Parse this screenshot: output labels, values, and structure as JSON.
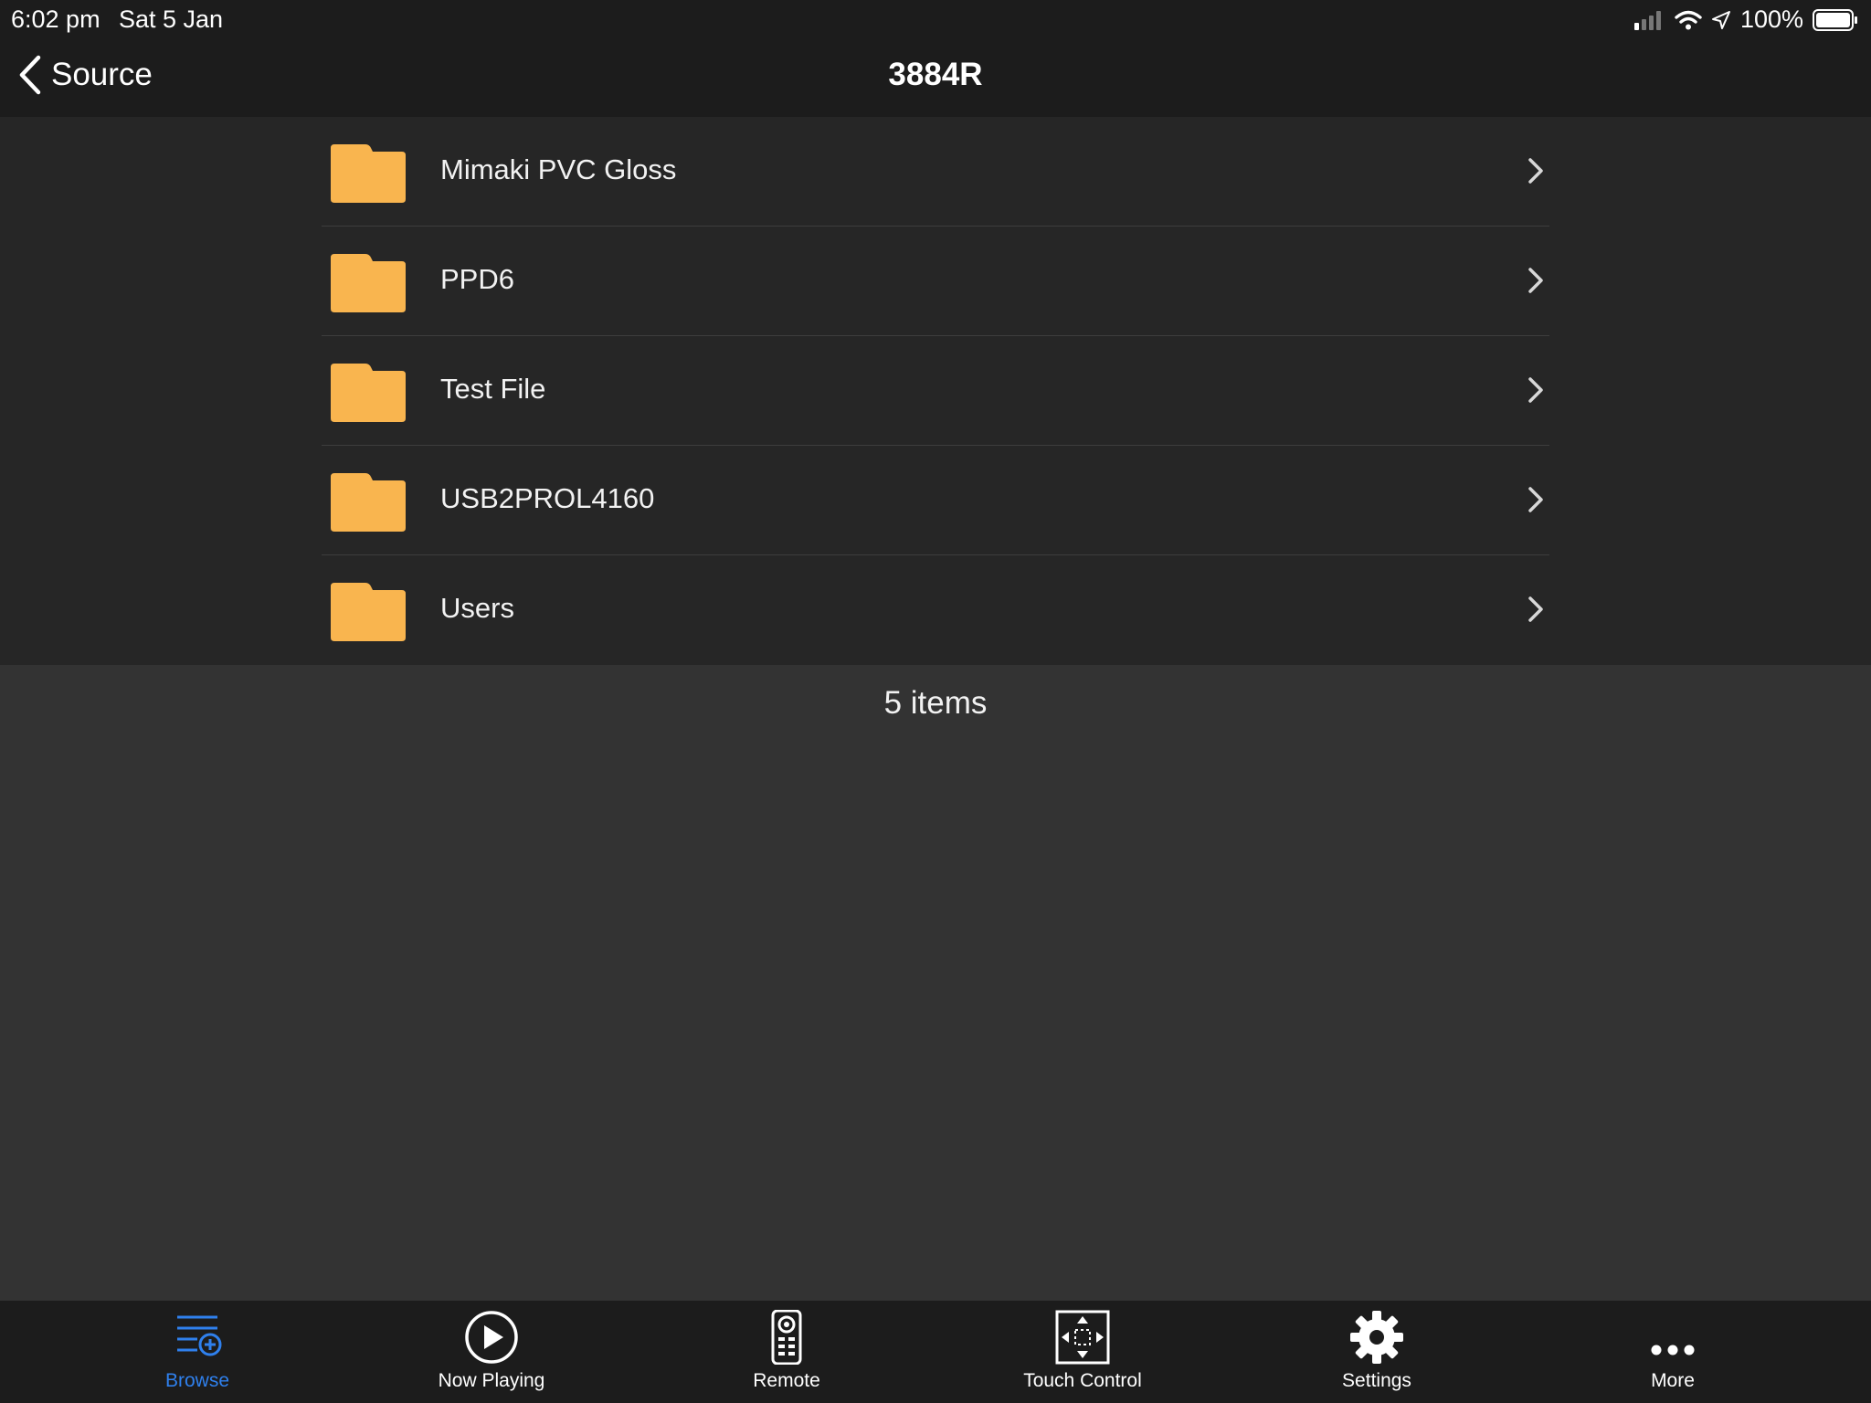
{
  "status_bar": {
    "time": "6:02 pm",
    "date": "Sat 5 Jan",
    "battery": "100%"
  },
  "nav": {
    "back_label": "Source",
    "title": "3884R"
  },
  "folders": [
    {
      "label": "Mimaki PVC Gloss",
      "icon": "folder-icon"
    },
    {
      "label": "PPD6",
      "icon": "folder-icon"
    },
    {
      "label": "Test File",
      "icon": "folder-icon"
    },
    {
      "label": "USB2PROL4160",
      "icon": "folder-icon"
    },
    {
      "label": "Users",
      "icon": "folder-icon"
    }
  ],
  "items_count": "5 items",
  "tabs": [
    {
      "label": "Browse",
      "icon": "browse-icon",
      "active": true
    },
    {
      "label": "Now Playing",
      "icon": "play-icon",
      "active": false
    },
    {
      "label": "Remote",
      "icon": "remote-icon",
      "active": false
    },
    {
      "label": "Touch Control",
      "icon": "touch-control-icon",
      "active": false
    },
    {
      "label": "Settings",
      "icon": "gear-icon",
      "active": false
    },
    {
      "label": "More",
      "icon": "more-icon",
      "active": false
    }
  ],
  "colors": {
    "folder": "#F9B54F",
    "accent": "#2F80ED",
    "bars_background": "#1C1C1C",
    "list_background": "#262626",
    "page_background": "#333333"
  }
}
